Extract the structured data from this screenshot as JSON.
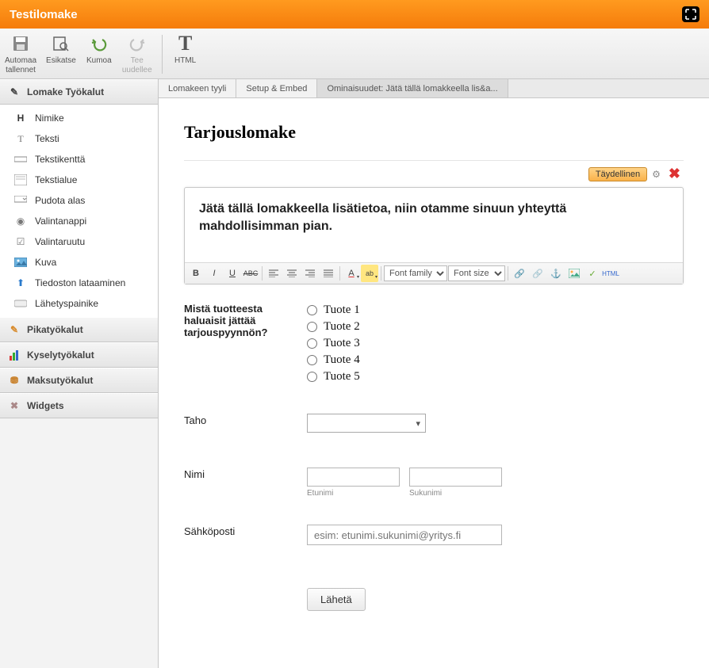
{
  "window": {
    "title": "Testilomake"
  },
  "toolbar": [
    {
      "label": "Automaa\ntallennet",
      "icon": "save"
    },
    {
      "label": "Esikatse",
      "icon": "preview"
    },
    {
      "label": "Kumoa",
      "icon": "undo"
    },
    {
      "label": "Tee\nuudellee",
      "icon": "redo",
      "disabled": true
    },
    {
      "label": "HTML",
      "icon": "html",
      "sep_before": true
    }
  ],
  "sidebar": {
    "sections": [
      {
        "label": "Lomake Työkalut",
        "icon": "pencil",
        "expanded": true,
        "items": [
          {
            "label": "Nimike",
            "icon": "H"
          },
          {
            "label": "Teksti",
            "icon": "T"
          },
          {
            "label": "Tekstikenttä",
            "icon": "textfield"
          },
          {
            "label": "Tekstialue",
            "icon": "textarea"
          },
          {
            "label": "Pudota alas",
            "icon": "dropdown"
          },
          {
            "label": "Valintanappi",
            "icon": "radio"
          },
          {
            "label": "Valintaruutu",
            "icon": "checkbox"
          },
          {
            "label": "Kuva",
            "icon": "image"
          },
          {
            "label": "Tiedoston lataaminen",
            "icon": "upload"
          },
          {
            "label": "Lähetyspainike",
            "icon": "button"
          }
        ]
      },
      {
        "label": "Pikatyökalut",
        "icon": "pencil"
      },
      {
        "label": "Kyselytyökalut",
        "icon": "chart"
      },
      {
        "label": "Maksutyökalut",
        "icon": "coins"
      },
      {
        "label": "Widgets",
        "icon": "wrench"
      }
    ]
  },
  "tabs": [
    {
      "label": "Lomakeen tyyli"
    },
    {
      "label": "Setup & Embed"
    },
    {
      "label": "Ominaisuudet: Jätä tällä lomakkeella lis&a...",
      "selected": true
    }
  ],
  "form": {
    "title": "Tarjouslomake",
    "selected_element": {
      "button_label": "Täydellinen",
      "text": "Jätä tällä lomakkeella lisätietoa, niin otamme sinuun yhteyttä mahdollisimman pian."
    },
    "rte": {
      "font_family_placeholder": "Font family",
      "font_size_placeholder": "Font size"
    },
    "product_question": {
      "label": "Mistä tuotteesta haluaisit jättää tarjouspyynnön?",
      "options": [
        "Tuote 1",
        "Tuote 2",
        "Tuote 3",
        "Tuote 4",
        "Tuote 5"
      ]
    },
    "taho": {
      "label": "Taho"
    },
    "nimi": {
      "label": "Nimi",
      "first_sub": "Etunimi",
      "last_sub": "Sukunimi"
    },
    "email": {
      "label": "Sähköposti",
      "placeholder": "esim: etunimi.sukunimi@yritys.fi"
    },
    "submit": {
      "label": "Lähetä"
    }
  }
}
